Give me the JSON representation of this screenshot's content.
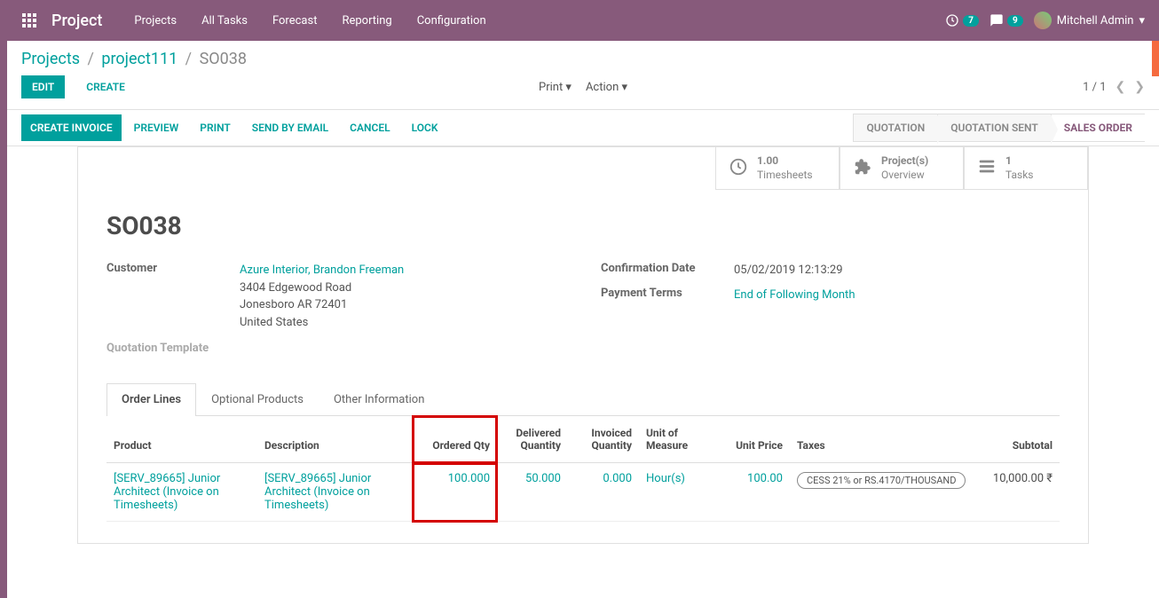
{
  "topbar": {
    "app_title": "Project",
    "nav": [
      "Projects",
      "All Tasks",
      "Forecast",
      "Reporting",
      "Configuration"
    ],
    "activity_count": "7",
    "message_count": "9",
    "user_name": "Mitchell Admin"
  },
  "breadcrumb": {
    "root": "Projects",
    "parent": "project111",
    "current": "SO038"
  },
  "buttons": {
    "edit": "EDIT",
    "create": "CREATE",
    "print": "Print",
    "action": "Action",
    "create_invoice": "CREATE INVOICE",
    "preview": "PREVIEW",
    "print_btn": "PRINT",
    "send_email": "SEND BY EMAIL",
    "cancel": "CANCEL",
    "lock": "LOCK"
  },
  "pager": {
    "current": "1 / 1"
  },
  "status": {
    "quotation": "QUOTATION",
    "quotation_sent": "QUOTATION SENT",
    "sales_order": "SALES ORDER"
  },
  "stat_buttons": {
    "timesheets": {
      "value": "1.00",
      "label": "Timesheets"
    },
    "projects": {
      "value": "Project(s)",
      "label": "Overview"
    },
    "tasks": {
      "value": "1",
      "label": "Tasks"
    }
  },
  "form": {
    "title": "SO038",
    "customer_label": "Customer",
    "customer_name": "Azure Interior, Brandon Freeman",
    "customer_addr1": "3404 Edgewood Road",
    "customer_addr2": "Jonesboro AR 72401",
    "customer_country": "United States",
    "quotation_template_label": "Quotation Template",
    "confirmation_date_label": "Confirmation Date",
    "confirmation_date": "05/02/2019 12:13:29",
    "payment_terms_label": "Payment Terms",
    "payment_terms": "End of Following Month"
  },
  "tabs": {
    "order_lines": "Order Lines",
    "optional_products": "Optional Products",
    "other_info": "Other Information"
  },
  "table": {
    "headers": {
      "product": "Product",
      "description": "Description",
      "ordered_qty": "Ordered Qty",
      "delivered_qty": "Delivered Quantity",
      "invoiced_qty": "Invoiced Quantity",
      "uom": "Unit of Measure",
      "unit_price": "Unit Price",
      "taxes": "Taxes",
      "subtotal": "Subtotal"
    },
    "row": {
      "product": "[SERV_89665] Junior Architect (Invoice on Timesheets)",
      "description": "[SERV_89665] Junior Architect (Invoice on Timesheets)",
      "ordered_qty": "100.000",
      "delivered_qty": "50.000",
      "invoiced_qty": "0.000",
      "uom": "Hour(s)",
      "unit_price": "100.00",
      "taxes": "CESS 21% or RS.4170/THOUSAND",
      "subtotal": "10,000.00 ₹"
    }
  }
}
